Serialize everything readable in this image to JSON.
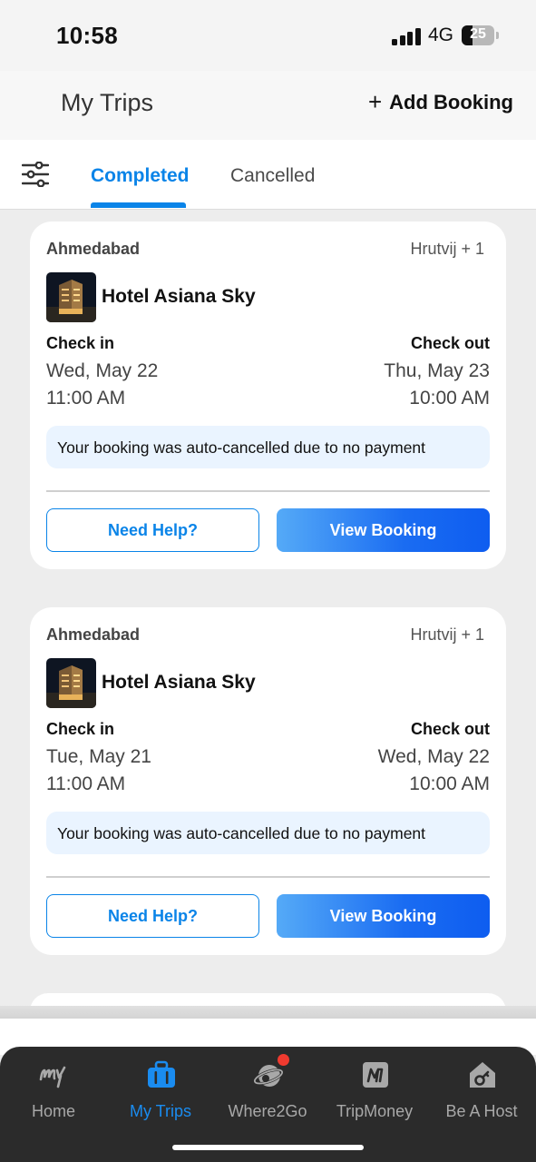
{
  "status_bar": {
    "time": "10:58",
    "network": "4G",
    "battery_level": "25"
  },
  "header": {
    "title": "My Trips",
    "add_booking_label": "Add Booking"
  },
  "tabs": {
    "completed": "Completed",
    "cancelled": "Cancelled",
    "active": "Completed"
  },
  "bookings": [
    {
      "city": "Ahmedabad",
      "guests": "Hrutvij + 1",
      "hotel_name": "Hotel Asiana Sky",
      "check_in_label": "Check in",
      "check_out_label": "Check out",
      "check_in_date": "Wed, May 22",
      "check_in_time": "11:00 AM",
      "check_out_date": "Thu, May 23",
      "check_out_time": "10:00 AM",
      "notice": "Your booking was auto-cancelled due to no payment",
      "help_label": "Need Help?",
      "view_label": "View Booking"
    },
    {
      "city": "Ahmedabad",
      "guests": "Hrutvij + 1",
      "hotel_name": "Hotel Asiana Sky",
      "check_in_label": "Check in",
      "check_out_label": "Check out",
      "check_in_date": "Tue, May 21",
      "check_in_time": "11:00 AM",
      "check_out_date": "Wed, May 22",
      "check_out_time": "10:00 AM",
      "notice": "Your booking was auto-cancelled due to no payment",
      "help_label": "Need Help?",
      "view_label": "View Booking"
    }
  ],
  "bottom_nav": [
    {
      "label": "Home",
      "icon": "mmt-logo-icon"
    },
    {
      "label": "My Trips",
      "icon": "briefcase-icon",
      "active": true
    },
    {
      "label": "Where2Go",
      "icon": "planet-icon",
      "notification": true
    },
    {
      "label": "TripMoney",
      "icon": "tripmoney-icon"
    },
    {
      "label": "Be A Host",
      "icon": "host-key-icon"
    }
  ],
  "colors": {
    "accent": "#0a84e8",
    "nav_bg": "#2b2b2b",
    "notice_bg": "#eaf4ff",
    "notification_dot": "#f03a2f"
  }
}
